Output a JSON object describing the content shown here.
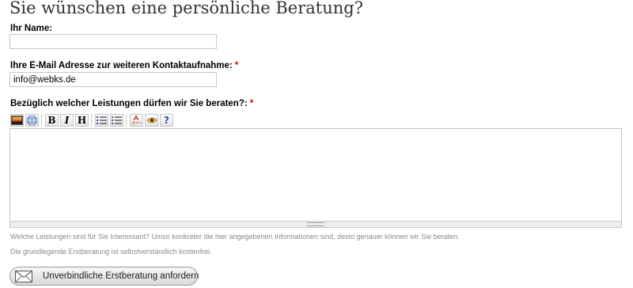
{
  "page": {
    "title": "Sie wünschen eine persönliche Beratung?"
  },
  "form": {
    "name": {
      "label": "Ihr Name:",
      "value": ""
    },
    "email": {
      "label": "Ihre E-Mail Adresse zur weiteren Kontaktaufnahme:",
      "required_mark": "*",
      "value": "info@webks.de"
    },
    "message": {
      "label": "Bezüglich welcher Leistungen dürfen wir Sie beraten?:",
      "required_mark": "*",
      "value": ""
    },
    "toolbar": {
      "buttons": [
        {
          "icon": "insert-image-icon"
        },
        {
          "icon": "insert-link-icon"
        },
        {
          "icon": "bold-icon",
          "glyph": "B"
        },
        {
          "icon": "italic-icon",
          "glyph": "I"
        },
        {
          "icon": "heading-icon",
          "glyph": "H"
        },
        {
          "icon": "ordered-list-icon"
        },
        {
          "icon": "unordered-list-icon"
        },
        {
          "icon": "spellcheck-icon"
        },
        {
          "icon": "preview-icon"
        },
        {
          "icon": "help-icon",
          "glyph": "?"
        }
      ]
    },
    "help_lines": [
      "Welche Leistungen sind für Sie Interessant? Umso konkreter die hier angegebenen Informationen sind, desto genauer können wir Sie beraten.",
      "Die grundlegende Erstberatung ist selbstverständlich kostenfrei."
    ],
    "submit": {
      "label": "Unverbindliche Erstberatung anfordern",
      "icon": "envelope-icon"
    }
  },
  "colors": {
    "title": "#333333",
    "required": "#cc0000",
    "help_text": "#8a8a8a",
    "border": "#c8c8c8"
  }
}
